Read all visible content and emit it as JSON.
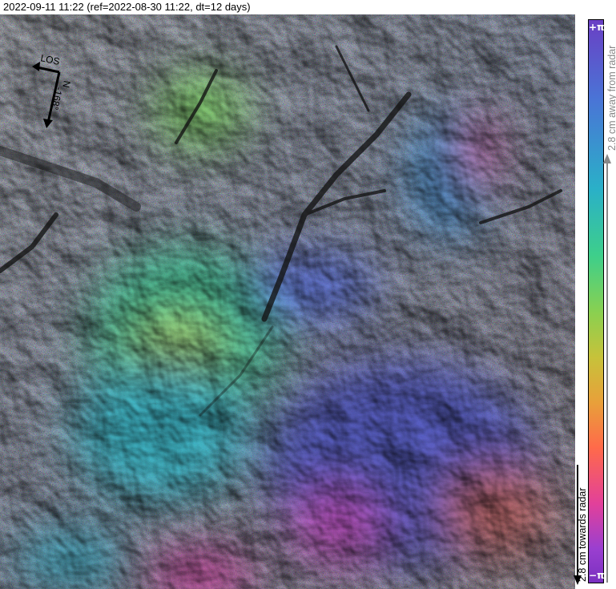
{
  "title": "2022-09-11 11:22 (ref=2022-08-30 11:22, dt=12 days)",
  "compass": {
    "los_label": "LOS",
    "north_label": "N",
    "heading_label": "-168°",
    "icon": "compass-arrows-icon"
  },
  "colorbar": {
    "top_label": "+π",
    "bottom_label": "−π",
    "away_label": "2.8 cm away from radar",
    "towards_label": "2.8 cm towards radar",
    "colors": [
      "#6a3fc4",
      "#4a74d6",
      "#2ab0c8",
      "#3ecf8a",
      "#8ad050",
      "#c7c23a",
      "#e8a03a",
      "#ff6a4a",
      "#e2409a",
      "#9a3fd0"
    ],
    "away_color": "#888888",
    "towards_color": "#000000"
  }
}
